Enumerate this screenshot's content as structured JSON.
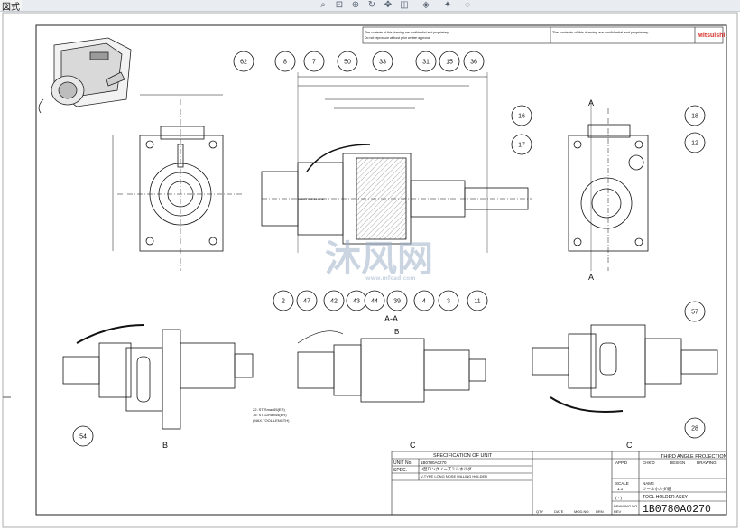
{
  "window": {
    "menu_label": "図式",
    "toolbar_icons": [
      "zoom-fit-icon",
      "zoom-area-icon",
      "zoom-in-out-icon",
      "rotate-icon",
      "pan-icon",
      "section-view-icon",
      "display-style-icon",
      "lights-icon",
      "scene-icon"
    ]
  },
  "title_block": {
    "header_note": "The contents of this drawing are confidential and proprietary",
    "header_note2": "Do not reproduce without prior written approval",
    "logo_text": "Mitsuishi",
    "spec_header": "SPECIFICATION OF UNIT",
    "unit_no_label": "UNIT No.",
    "unit_no_value": "1B0780A0270",
    "spec_label": "SPEC.",
    "spec_value_jp": "V型ロングノーズミルホルダ",
    "spec_value_en": "V-TYPE LONG NOSE MILLING HOLDER",
    "projection": "THIRD ANGLE PROJECTION",
    "appd": "APP'D",
    "chk": "CHK'D",
    "design": "DESIGN",
    "drawing": "DRAWING",
    "scale_label": "SCALE",
    "scale_value": "1:1",
    "scale_paren": "( - )",
    "name_label": "NAME",
    "name_jp": "ツールホルダ組",
    "name_en": "TOOL HOLDER ASSY",
    "drawing_no_label": "DRAWING NO.",
    "drawing_no": "1B0780A0270",
    "footer": [
      "QTY",
      "DATE",
      "MOD.NO.",
      "DRN",
      "REV"
    ]
  },
  "views": {
    "section_label": "A-A",
    "section_mark": "A",
    "view_b": "B",
    "view_c": "C",
    "watermark": "沐风网",
    "watermark_url": "www.mfcad.com"
  },
  "balloons": [
    "62",
    "8",
    "7",
    "50",
    "33",
    "31",
    "15",
    "36",
    "16",
    "17",
    "18",
    "12",
    "2",
    "47",
    "42",
    "43",
    "44",
    "39",
    "4",
    "3",
    "11",
    "54",
    "57",
    "28"
  ],
  "notes": {
    "max_tool": "(MAX.TOOL LENGTH)",
    "master_mark": "MASTER MARK",
    "tool_note": "22: ST-Smax65(ER)",
    "tool_note2": "16: ST-12max45(ER)"
  }
}
